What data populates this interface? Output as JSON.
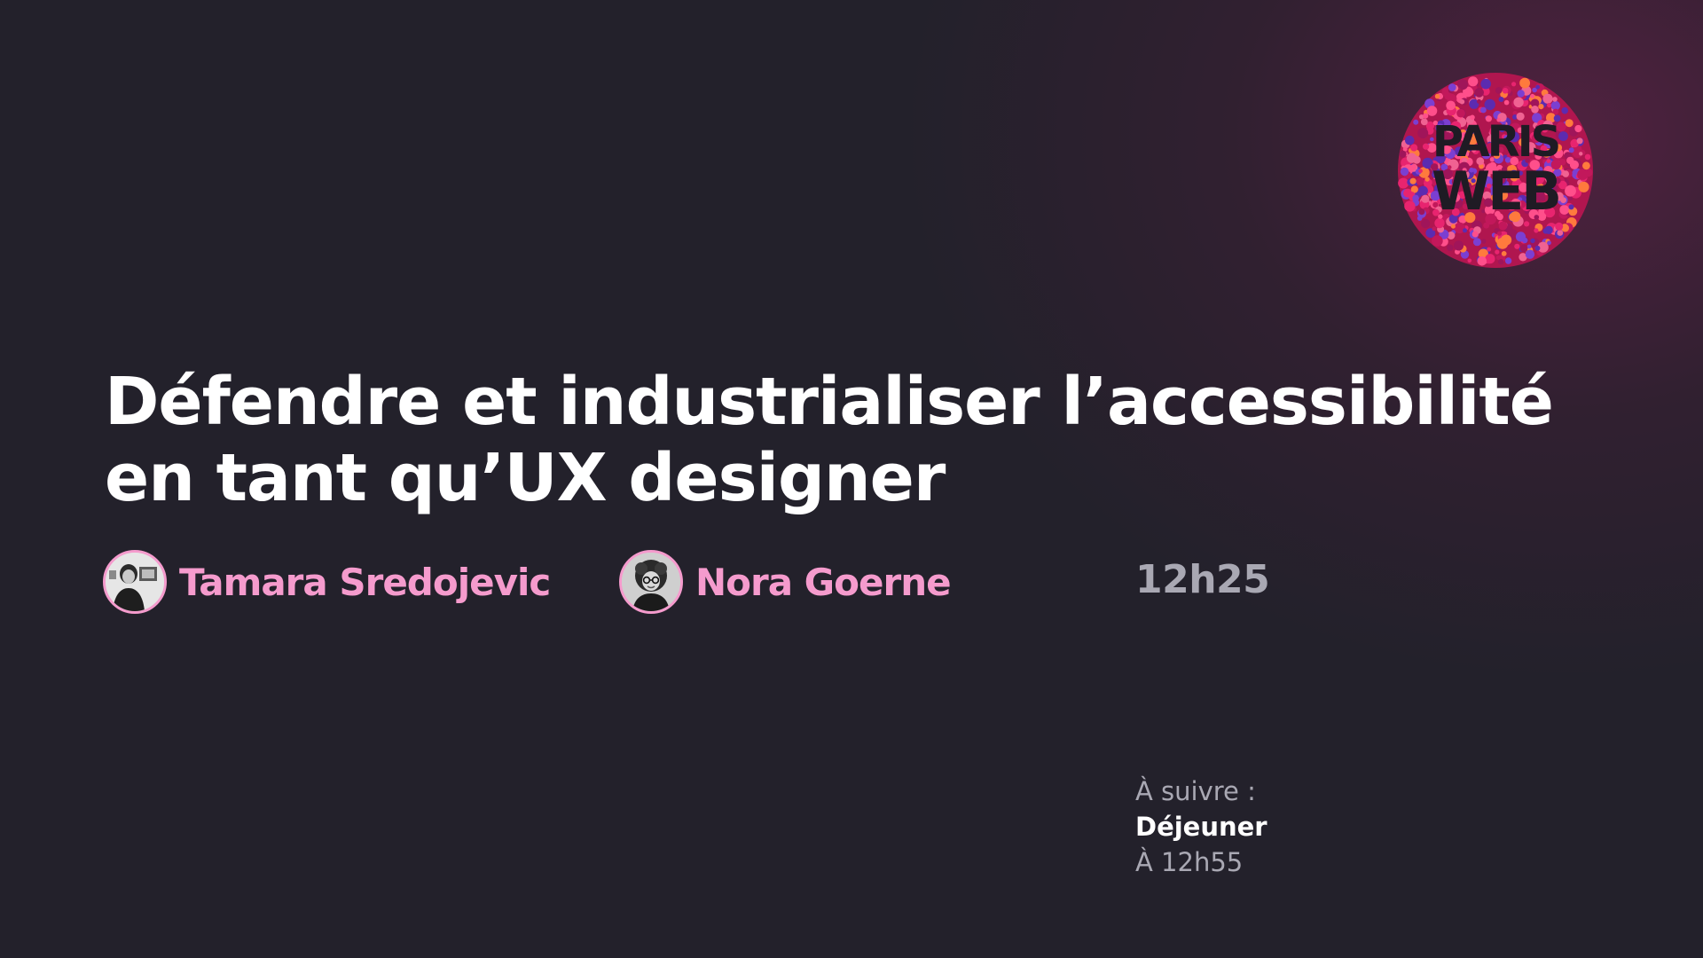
{
  "logo": {
    "line1": "PARIS",
    "line2": "WEB",
    "colors": [
      "#e8246f",
      "#c2185b",
      "#ff4f8b",
      "#7b3fd1",
      "#ff7a3d",
      "#a0155a",
      "#f06292",
      "#5c2bb0"
    ],
    "text_color": "#1f1b24"
  },
  "talk": {
    "title_line1": "Défendre et industrialiser l’accessibilité",
    "title_line2": "en tant qu’UX designer",
    "time": "12h25"
  },
  "speakers": [
    {
      "name": "Tamara Sredojevic",
      "avatar_icon": "speaker-photo-icon"
    },
    {
      "name": "Nora Goerne",
      "avatar_icon": "speaker-photo-icon"
    }
  ],
  "next": {
    "label": "À suivre :",
    "title": "Déjeuner",
    "time": "À 12h55"
  },
  "colors": {
    "background": "#23212b",
    "accent_pink": "#f59bcd",
    "muted_text": "#a9a8b3",
    "title_text": "#ffffff"
  }
}
